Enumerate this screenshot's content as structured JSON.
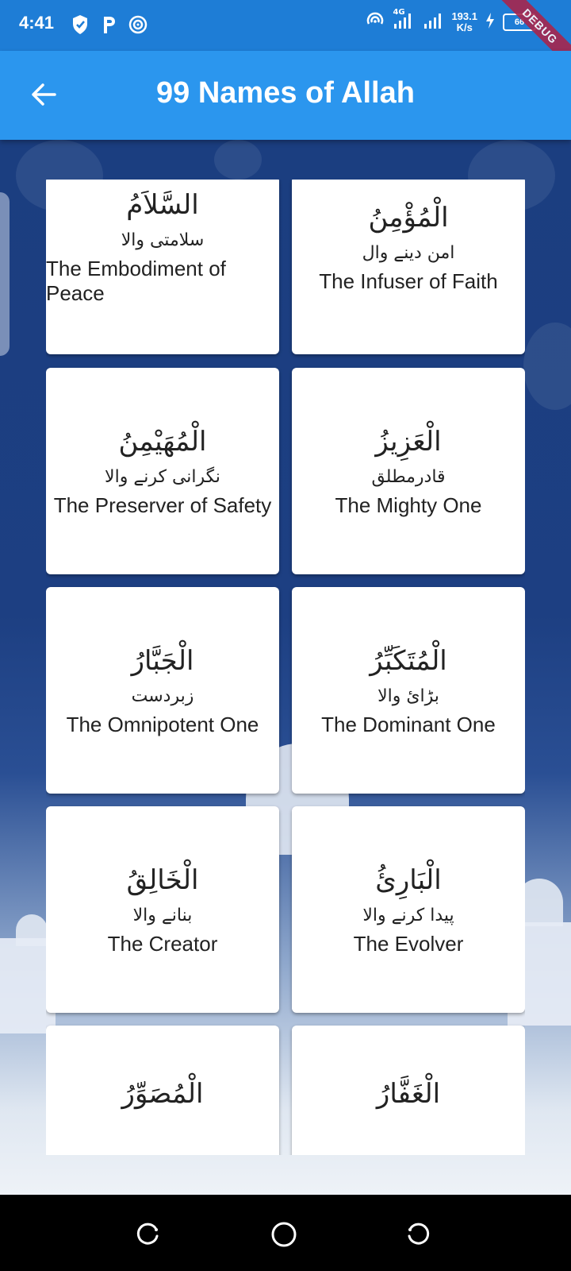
{
  "status_bar": {
    "time": "4:41",
    "network": "4G",
    "speed_value": "193.1",
    "speed_unit": "K/s",
    "battery": "66",
    "debug_label": "DEBUG"
  },
  "app_bar": {
    "title": "99 Names of Allah",
    "back_icon": "arrow-left-icon",
    "color": "#2b96ee"
  },
  "names": [
    {
      "arabic": "السَّلاَمُ",
      "urdu": "سلامتی والا",
      "english": "The Embodiment of Peace"
    },
    {
      "arabic": "الْمُؤْمِنُ",
      "urdu": "امن دینے وال",
      "english": "The Infuser of Faith"
    },
    {
      "arabic": "الْمُهَيْمِنُ",
      "urdu": "نگرانی کرنے والا",
      "english": "The Preserver of Safety"
    },
    {
      "arabic": "الْعَزِيزُ",
      "urdu": "قادرمطلق",
      "english": "The Mighty One"
    },
    {
      "arabic": "الْجَبَّارُ",
      "urdu": "زبردست",
      "english": "The Omnipotent One"
    },
    {
      "arabic": "الْمُتَكَبِّرُ",
      "urdu": "بڑائ والا",
      "english": "The Dominant One"
    },
    {
      "arabic": "الْخَالِقُ",
      "urdu": "بنانے والا",
      "english": "The Creator"
    },
    {
      "arabic": "الْبَارِئُ",
      "urdu": "پیدا کرنے والا",
      "english": "The Evolver"
    },
    {
      "arabic": "الْمُصَوِّرُ",
      "urdu": "",
      "english": ""
    },
    {
      "arabic": "الْغَفَّارُ",
      "urdu": "",
      "english": ""
    }
  ],
  "nav_bar": {
    "left_icon": "recent-apps-icon",
    "center_icon": "home-icon",
    "right_icon": "back-nav-icon"
  }
}
